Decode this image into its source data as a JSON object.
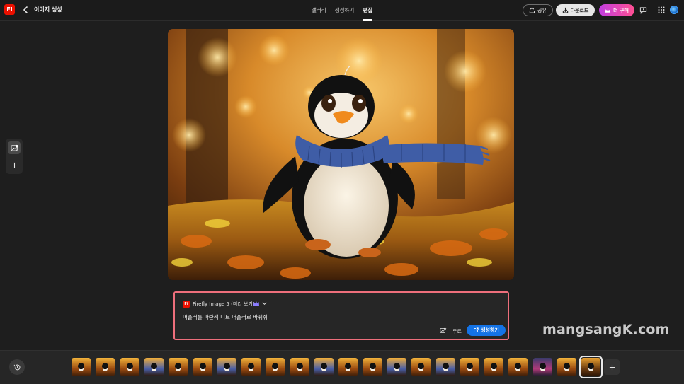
{
  "header": {
    "logo_text": "Fi",
    "page_title": "이미지 생성",
    "tabs": [
      {
        "label": "갤러리",
        "active": false
      },
      {
        "label": "생성하기",
        "active": false
      },
      {
        "label": "편집",
        "active": true
      }
    ],
    "share_label": "공유",
    "download_label": "다운로드",
    "buy_label": "더 구매"
  },
  "colors": {
    "accent_blue": "#1473e6",
    "brand_red": "#eb1000",
    "prompt_border": "#ee6f7c",
    "buy_gradient_start": "#c13ee0",
    "buy_gradient_end": "#ff4f91"
  },
  "left_tools": {
    "icons": [
      "reference-image-icon",
      "plus-icon"
    ]
  },
  "prompt_panel": {
    "model_logo_text": "Fi",
    "model_name": "Firefly Image 5 (미리 보기)",
    "prompt_text": "머플러를 파란색 니트 머플러로 바꿔줘",
    "cost_label": "무료",
    "generate_label": "생성하기"
  },
  "watermark": "mangsangK.com",
  "thumbnails": {
    "count": 22,
    "selected_index": 21,
    "variants": [
      "warm",
      "warm",
      "warm",
      "blue",
      "warm",
      "warm",
      "blue",
      "warm",
      "warm",
      "warm",
      "blue",
      "warm",
      "warm",
      "blue",
      "warm",
      "blue",
      "warm",
      "warm",
      "warm",
      "dark",
      "warm",
      "selected"
    ]
  }
}
